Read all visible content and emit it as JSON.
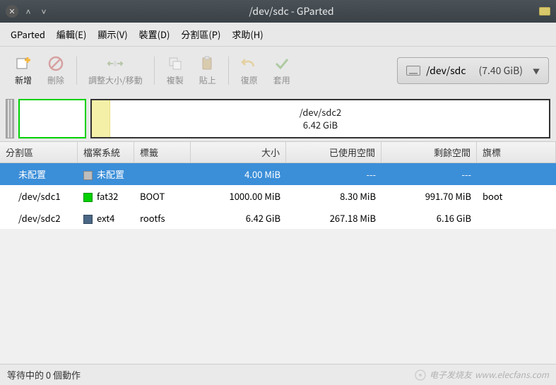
{
  "window": {
    "title": "/dev/sdc - GParted"
  },
  "menu": {
    "gparted": "GParted",
    "edit": "編輯(E)",
    "view": "顯示(V)",
    "device": "裝置(D)",
    "partition": "分割區(P)",
    "help": "求助(H)"
  },
  "toolbar": {
    "new": "新增",
    "delete": "刪除",
    "resize": "調整大小/移動",
    "copy": "複製",
    "paste": "貼上",
    "undo": "復原",
    "apply": "套用"
  },
  "device_selector": {
    "name": "/dev/sdc",
    "size": "(7.40 GiB)"
  },
  "diskmap": {
    "part2_name": "/dev/sdc2",
    "part2_size": "6.42 GiB"
  },
  "columns": {
    "partition": "分割區",
    "filesystem": "檔案系統",
    "label": "標籤",
    "size": "大小",
    "used": "已使用空間",
    "unused": "剩餘空間",
    "flags": "旗標"
  },
  "rows": [
    {
      "partition": "未配置",
      "fs": "未配置",
      "swatch": "fs-unalloc",
      "label": "",
      "size": "4.00 MiB",
      "used": "---",
      "unused": "---",
      "flags": "",
      "selected": true
    },
    {
      "partition": "/dev/sdc1",
      "fs": "fat32",
      "swatch": "fs-fat32",
      "label": "BOOT",
      "size": "1000.00 MiB",
      "used": "8.30 MiB",
      "unused": "991.70 MiB",
      "flags": "boot",
      "selected": false
    },
    {
      "partition": "/dev/sdc2",
      "fs": "ext4",
      "swatch": "fs-ext4",
      "label": "rootfs",
      "size": "6.42 GiB",
      "used": "267.18 MiB",
      "unused": "6.16 GiB",
      "flags": "",
      "selected": false
    }
  ],
  "status": {
    "pending": "等待中的 0 個動作"
  },
  "watermark": {
    "text": "www.elecfans.com",
    "brand": "电子发烧友"
  }
}
